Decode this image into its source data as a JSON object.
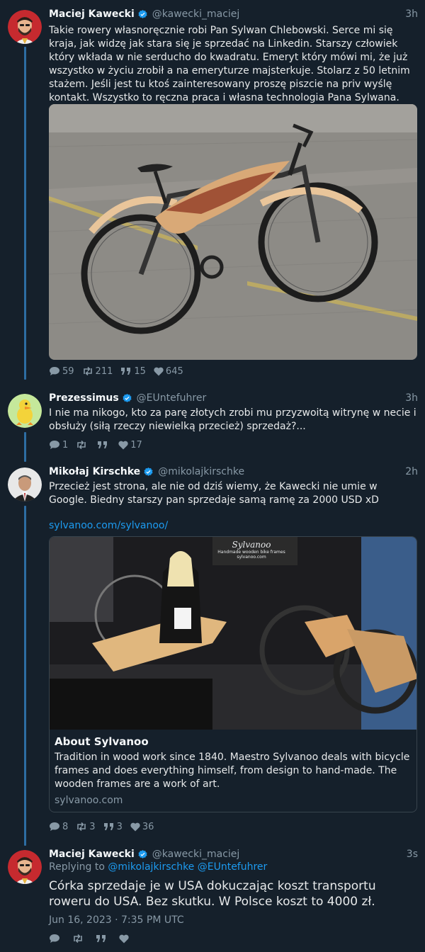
{
  "tweets": [
    {
      "name": "Maciej Kawecki",
      "handle": "@kawecki_maciej",
      "time": "3h",
      "text": "Takie rowery własnoręcznie robi Pan Sylwan Chlebowski. Serce mi się kraja, jak widzę jak stara się je sprzedać na Linkedin. Starszy człowiek który wkłada w nie serducho do kwadratu. Emeryt który mówi mi, że już wszystko w życiu zrobił a na emeryturze majsterkuje. Stolarz z 50 letnim stażem. Jeśli jest tu ktoś zainteresowany proszę piszcie na priv wyślę kontakt. Wszystko to ręczna praca i własna technologia Pana Sylwana.",
      "stats": {
        "replies": "59",
        "retweets": "211",
        "quotes": "15",
        "likes": "645"
      }
    },
    {
      "name": "Prezessimus",
      "handle": "@EUntefuhrer",
      "time": "3h",
      "text": "I nie ma nikogo, kto za parę złotych zrobi mu przyzwoitą witrynę w necie i obsłuży (siłą rzeczy niewielką przecież) sprzedaż?...",
      "stats": {
        "replies": "1",
        "retweets": "",
        "quotes": "",
        "likes": "17"
      }
    },
    {
      "name": "Mikołaj Kirschke",
      "handle": "@mikolajkirschke",
      "time": "2h",
      "text": "Przecież jest strona, ale nie od dziś wiemy, że Kawecki nie umie w Google. Biedny starszy pan sprzedaje samą ramę za 2000 USD xD",
      "link": "sylvanoo.com/sylvanoo/",
      "card": {
        "title": "About Sylvanoo",
        "description": "Tradition in wood work since 1840. Maestro Sylvanoo deals with bicycle frames and does everything himself, from design to hand-made. The wooden frames are a work of art.",
        "domain": "sylvanoo.com",
        "banner_title": "Sylvanoo",
        "banner_sub": "Handmade wooden bike frames",
        "banner_url": "sylvanoo.com"
      },
      "stats": {
        "replies": "8",
        "retweets": "3",
        "quotes": "3",
        "likes": "36"
      }
    },
    {
      "name": "Maciej Kawecki",
      "handle": "@kawecki_maciej",
      "time": "3s",
      "replying_label": "Replying to",
      "replying_to": "@mikolajkirschke @EUntefuhrer",
      "text": "Córka sprzedaje je w USA dokuczając koszt transportu roweru do USA. Bez skutku. W Polsce koszt to 4000 zł.",
      "date": "Jun 16, 2023 · 7:35 PM UTC",
      "stats": {
        "replies": "",
        "retweets": "",
        "quotes": "",
        "likes": ""
      }
    }
  ],
  "colors": {
    "background": "#15202b",
    "accent": "#1d9bf0",
    "muted": "#8899a6",
    "thread": "#2d6da3"
  }
}
